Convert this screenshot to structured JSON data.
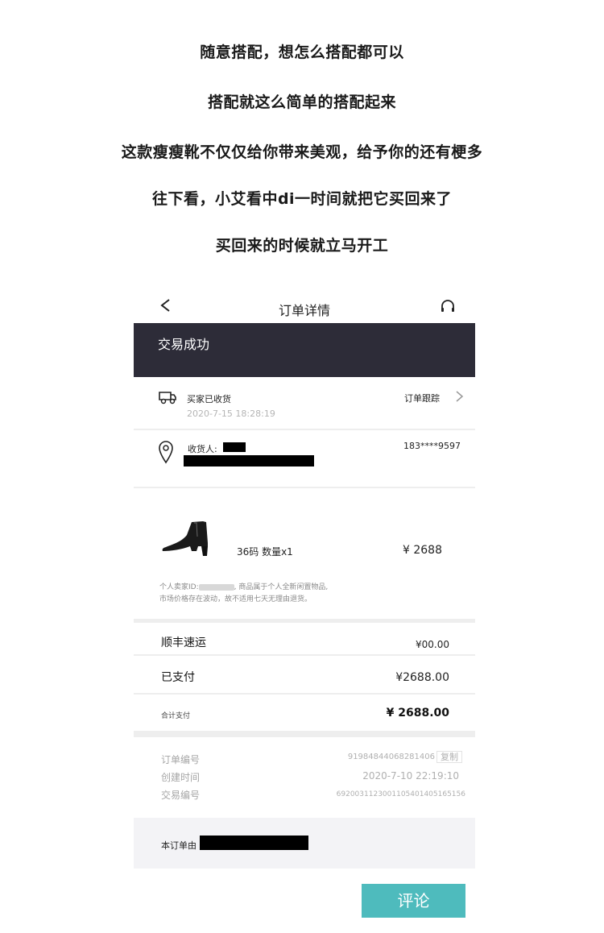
{
  "captions": [
    "随意搭配，想怎么搭配都可以",
    "搭配就这么简单的搭配起来",
    "这款瘦瘦靴不仅仅给你带来美观，给予你的还有梗多",
    "往下看，小艾看中di一时间就把它买回来了",
    "买回来的时候就立马开工"
  ],
  "nav": {
    "title": "订单详情",
    "back_icon": "chevron-left-icon",
    "service_icon": "headset-icon"
  },
  "banner": {
    "status": "交易成功",
    "color": "#2d2c38"
  },
  "delivery": {
    "status": "买家已收货",
    "time": "2020-7-15 18:28:19",
    "track_link": "订单跟踪"
  },
  "address": {
    "receiver_label": "收货人:",
    "phone": "183****9597"
  },
  "product": {
    "spec": "36码   数量x1",
    "price": "¥ 2688",
    "notice_prefix": "个人卖家ID:",
    "notice_line1_suffix": ", 商品属于个人全新闲置物品,",
    "notice_line2": "市场价格存在波动，故不适用七天无理由退货。"
  },
  "summary": {
    "shipping_label": "顺丰速运",
    "shipping_value": "¥00.00",
    "paid_label": "已支付",
    "paid_value": "¥2688.00",
    "total_label": "合计支付",
    "total_value": "¥ 2688.00"
  },
  "meta": {
    "order_no_label": "订单编号",
    "order_no": "91984844068281406",
    "copy_label": "复制",
    "created_label": "创建时间",
    "created": "2020-7-10  22:19:10",
    "trade_no_label": "交易编号",
    "trade_no": "692003112300110540140516515б"
  },
  "footer": {
    "label": "本订单由"
  },
  "review_button": {
    "label": "评论",
    "color": "#4ebbbd"
  }
}
